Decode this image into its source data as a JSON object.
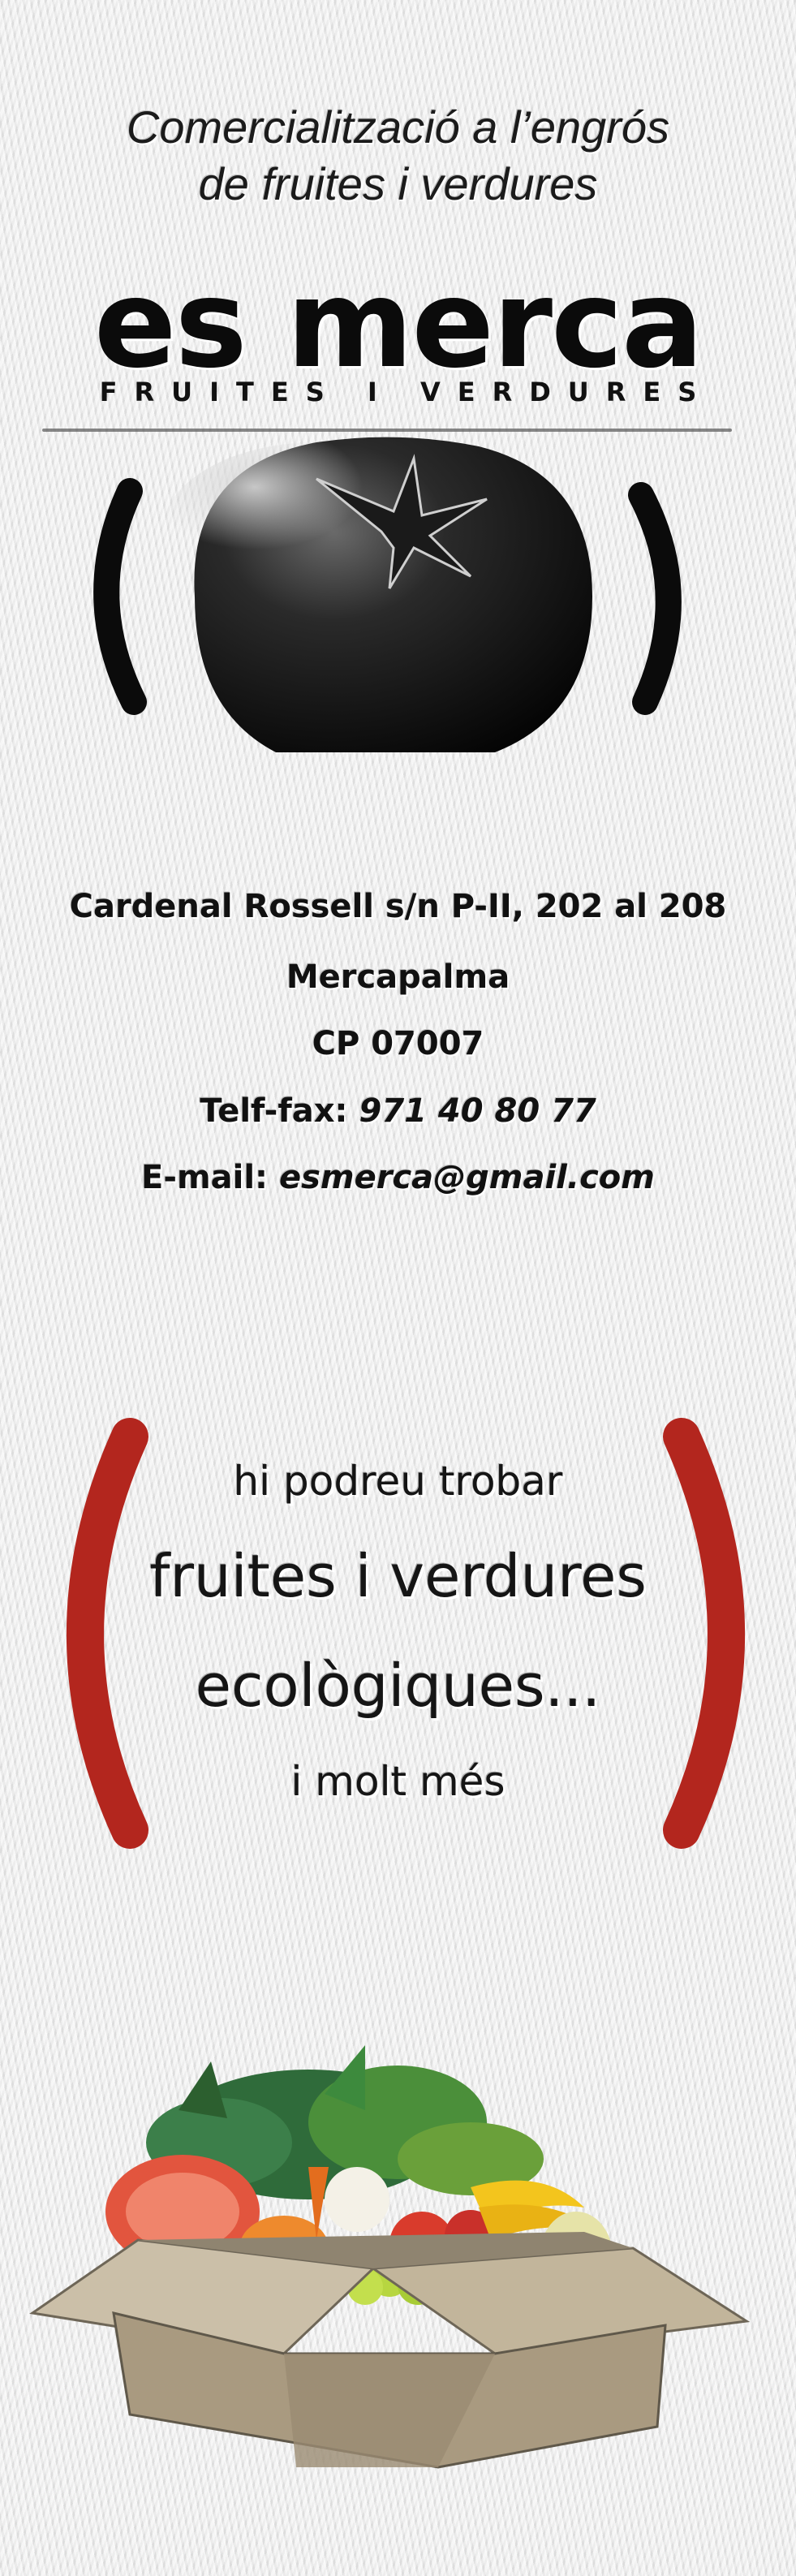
{
  "header": {
    "tagline_line1": "Comercialització a l’engrós",
    "tagline_line2": "de fruites i verdures",
    "brand_name": "es merca",
    "brand_subtitle": "FRUITES I VERDURES"
  },
  "contact": {
    "address": "Cardenal Rossell s/n P-II, 202 al 208",
    "city": "Mercapalma",
    "postcode": "CP 07007",
    "phone_label": "Telf-fax:",
    "phone_value": "971 40 80 77",
    "email_label": "E-mail:",
    "email_value": "esmerca@gmail.com"
  },
  "promo": {
    "line1": "hi podreu trobar",
    "line2": "fruites i verdures",
    "line3": "ecològiques...",
    "line4": "i molt més"
  },
  "colors": {
    "background": "#ececec",
    "text": "#111111",
    "accent_red": "#b3261e",
    "bracket_black": "#0b0b0b"
  },
  "icons": {
    "tomato": "tomato-illustration",
    "produce_box": "produce-box-illustration"
  }
}
